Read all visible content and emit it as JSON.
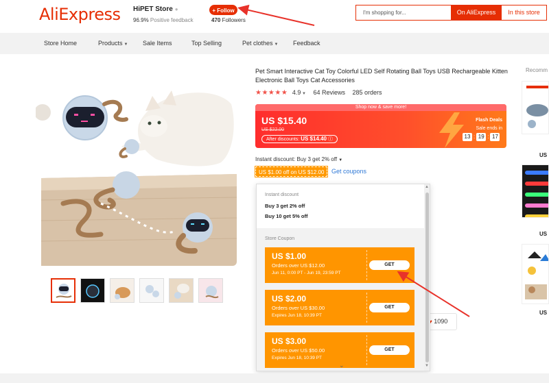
{
  "header": {
    "logo": "AliExpress",
    "store_name": "HiPET Store",
    "feedback_percent": "96.9%",
    "feedback_label": "Positive feedback",
    "follow_label": "+ Follow",
    "followers_count": "470",
    "followers_label": "Followers",
    "search_placeholder": "I'm shopping for...",
    "search_on_label": "On AliExpress",
    "search_store_label": "In this store"
  },
  "nav": {
    "items": [
      "Store Home",
      "Products",
      "Sale Items",
      "Top Selling",
      "Pet clothes",
      "Feedback"
    ]
  },
  "product": {
    "title": "Pet Smart Interactive Cat Toy Colorful LED Self Rotating Ball Toys USB Rechargeable Kitten Electronic Ball Toys Cat Accessories",
    "rating": "4.9",
    "reviews": "64 Reviews",
    "orders": "285 orders",
    "banner_top": "Shop now & save more!",
    "price": "US $15.40",
    "old_price": "US $22.00",
    "after_discounts_label": "After discounts:",
    "after_discounts_price": "US $14.40",
    "flash_deals": "Flash Deals",
    "sale_ends": "Sale ends in",
    "countdown": [
      "13",
      "19",
      "17"
    ],
    "instant_discount": "Instant discount: Buy 3 get 2% off",
    "coupon_chip": "US $1.00 off on US $12.00",
    "get_coupons": "Get coupons",
    "wishlist_count": "1090"
  },
  "dropdown": {
    "instant_label": "Instant discount",
    "instant_rules": [
      "Buy 3 get 2% off",
      "Buy 10 get 5% off"
    ],
    "store_coupon_label": "Store Coupon",
    "coupons": [
      {
        "amount": "US $1.00",
        "min": "Orders over US $12.00",
        "date": "Jun 11, 0:00 PT - Jun 19, 23:59 PT",
        "get": "GET"
      },
      {
        "amount": "US $2.00",
        "min": "Orders over US $30.00",
        "date": "Expires Jun 18, 10:39 PT",
        "get": "GET"
      },
      {
        "amount": "US $3.00",
        "min": "Orders over US $50.00",
        "date": "Expires Jun 18, 10:39 PT",
        "get": "GET"
      }
    ]
  },
  "recommended": {
    "title": "Recomm",
    "prices": [
      "US",
      "US",
      "US"
    ]
  },
  "colors": {
    "brand": "#e62e04",
    "coupon_orange": "#ff9500",
    "link_blue": "#2e78d6",
    "annotation_red": "#e8322a"
  }
}
